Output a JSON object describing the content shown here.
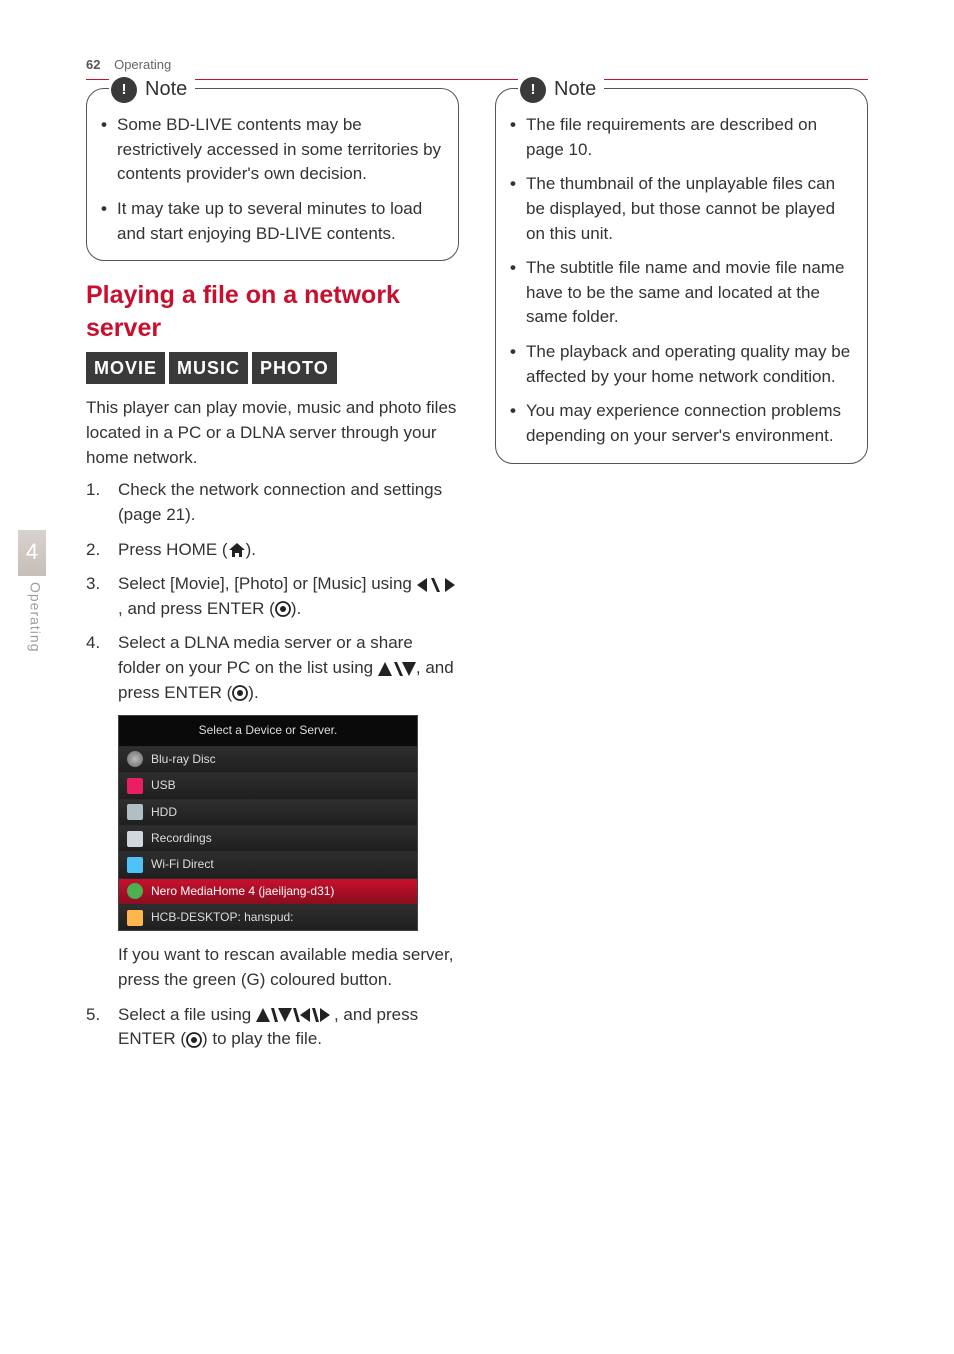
{
  "header": {
    "page_num": "62",
    "section": "Operating"
  },
  "side": {
    "chapter": "4",
    "label": "Operating"
  },
  "note1": {
    "title": "Note",
    "items": [
      "Some BD-LIVE contents may be restrictively accessed in some territories by contents provider's own decision.",
      "It may take up to several minutes to load and start enjoying BD-LIVE contents."
    ]
  },
  "heading": "Playing a file on a network server",
  "tags": [
    "MOVIE",
    "MUSIC",
    "PHOTO"
  ],
  "intro": "This player can play movie, music and photo files located in a PC or a DLNA server through your home network.",
  "steps": {
    "s1": "Check the network connection and settings (page 21).",
    "s2a": "Press HOME (",
    "s2b": ").",
    "s3a": "Select [Movie], [Photo] or [Music] using ",
    "s3b": ", and press ENTER (",
    "s3c": ").",
    "s4a": "Select a DLNA media server or a share folder on your PC on the list using ",
    "s4b": ", and press ENTER (",
    "s4c": ").",
    "s4_after": "If you want to rescan available media server, press the green (G) coloured button.",
    "s5a": "Select a file using ",
    "s5b": ", and press ENTER (",
    "s5c": ") to play the file."
  },
  "screenshot": {
    "title": "Select a Device or Server.",
    "rows": [
      {
        "label": "Blu-ray Disc",
        "icon": "disc",
        "sel": false
      },
      {
        "label": "USB",
        "icon": "usb",
        "sel": false
      },
      {
        "label": "HDD",
        "icon": "hdd",
        "sel": false
      },
      {
        "label": "Recordings",
        "icon": "rec",
        "sel": false
      },
      {
        "label": "Wi-Fi Direct",
        "icon": "wifi",
        "sel": false
      },
      {
        "label": "Nero MediaHome 4 (jaeiljang-d31)",
        "icon": "nero",
        "sel": true
      },
      {
        "label": "HCB-DESKTOP: hanspud:",
        "icon": "pc",
        "sel": false
      }
    ]
  },
  "note2": {
    "title": "Note",
    "items": [
      "The file requirements are described on page 10.",
      "The thumbnail of the unplayable files can be displayed, but those cannot be played on this unit.",
      "The subtitle file name and movie file name have to be the same and located at the same folder.",
      "The playback and operating quality may be affected by your home network condition.",
      "You may experience connection problems depending on your server's environment."
    ]
  }
}
